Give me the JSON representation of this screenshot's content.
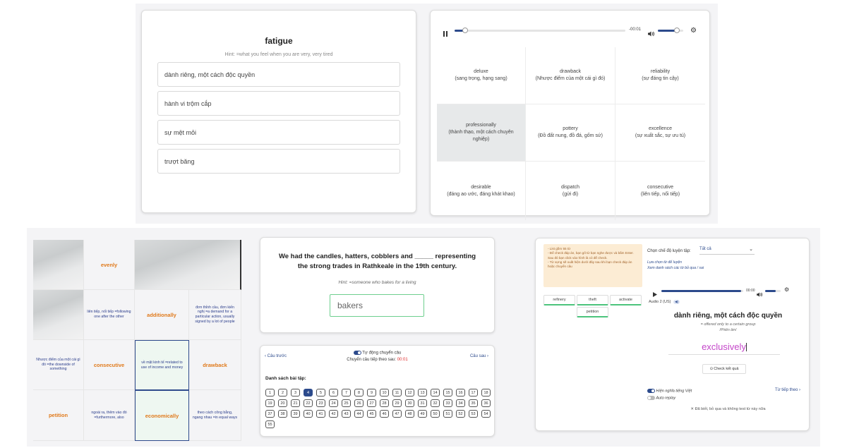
{
  "panel1": {
    "word": "fatigue",
    "hint": "Hint: =what you feel when you are very, very tired",
    "options": [
      "dành riêng, một cách độc quyền",
      "hành vi trộm cắp",
      "sự mệt mỏi",
      "trượt băng"
    ]
  },
  "panel2": {
    "time": "-00:01",
    "progress": 0.06,
    "volume": 0.75,
    "cells": [
      {
        "en": "deluxe",
        "vi": "(sang trọng, hạng sang)"
      },
      {
        "en": "drawback",
        "vi": "(Nhược điểm của một cái gì đó)"
      },
      {
        "en": "reliability",
        "vi": "(sự đáng tin cậy)"
      },
      {
        "en": "professionally",
        "vi": "(thành thạo, một cách chuyên nghiệp)"
      },
      {
        "en": "pottery",
        "vi": "(Đồ đất nung, đồ đá, gốm sứ)"
      },
      {
        "en": "excellence",
        "vi": "(sự xuất sắc, sự ưu tú)"
      },
      {
        "en": "desirable",
        "vi": "(đáng ao ước, đáng khát khao)"
      },
      {
        "en": "dispatch",
        "vi": "(gửi đi)"
      },
      {
        "en": "consecutive",
        "vi": "(liên tiếp, nối tiếp)"
      }
    ]
  },
  "panel3": {
    "row1": {
      "word": "evenly"
    },
    "row2": {
      "def1": "liên tiếp, nối tiếp =following one after the other",
      "word": "additionally",
      "def2": "đơn thỉnh cầu, đơn kiến nghị =a demand for a particular action, usually signed by a lot of people"
    },
    "row3": {
      "def1": "Nhược điểm của một cái gì đó =the downside of something",
      "word1": "consecutive",
      "def2": "về mặt kinh tế =related to use of income and money",
      "word2": "drawback"
    },
    "row4": {
      "word1": "petition",
      "def1": "ngoài ra, thêm vào đó =furthermore, also",
      "word2": "economically",
      "def2": "theo cách công bằng, ngang nhau =in equal ways"
    }
  },
  "panel4": {
    "question": "We had the candles, hatters, cobblers and _____ representing the strong trades in Rathkeale in the 19th century.",
    "hint": "Hint: =someone who bakes for a living",
    "answer": "bakers",
    "prev": "Câu trước",
    "auto_label": "Tự động chuyển câu",
    "next_label": "Chuyển câu tiếp theo sau:",
    "countdown": "00:01",
    "next": "Câu sau",
    "list_title": "Danh sách bài tập:",
    "numbers": [
      "1",
      "2",
      "3",
      "4",
      "5",
      "6",
      "7",
      "8",
      "9",
      "10",
      "11",
      "12",
      "13",
      "14",
      "15",
      "16",
      "17",
      "18",
      "19",
      "20",
      "21",
      "22",
      "23",
      "24",
      "25",
      "26",
      "27",
      "28",
      "29",
      "30",
      "31",
      "32",
      "33",
      "34",
      "35",
      "36",
      "37",
      "38",
      "39",
      "40",
      "41",
      "42",
      "43",
      "44",
      "45",
      "46",
      "47",
      "48",
      "49",
      "50",
      "51",
      "52",
      "53",
      "54",
      "55"
    ],
    "current": "4"
  },
  "panel5": {
    "note_lines": [
      "- List gồm 55 từ",
      "- Để check đáp án, bạn gõ từ bạn nghe được và bấm Enter. Sau đó bạn click vào hình là có để check.",
      "- Từ vựng sẽ xuất hiện dưới đây sau khi bạn check đáp án hoặc chuyển câu"
    ],
    "mode_label": "Chọn chế độ luyện tập:",
    "mode_value": "Tất cả",
    "link1": "Lựa chọn từ để luyện",
    "link2": "Xem danh sách các từ bỏ qua / sai",
    "chips": [
      "refinery",
      "theft",
      "activate",
      "petition"
    ],
    "time": "00:00",
    "progress": 0.97,
    "volume": 0.7,
    "audio_label": "Audio 2 (US)",
    "definition": "dành riêng, một cách độc quyền",
    "meaning": "= offered only to a certain group",
    "phonetic": "/Phiên âm/",
    "answer": "exclusively",
    "check_label": "Check kết quả",
    "show_vn": "Hiện nghĩa tiếng Việt",
    "auto_replay": "Auto replay",
    "next_word": "Từ tiếp theo",
    "skip": "Đã biết, bỏ qua và không test từ này nữa"
  }
}
